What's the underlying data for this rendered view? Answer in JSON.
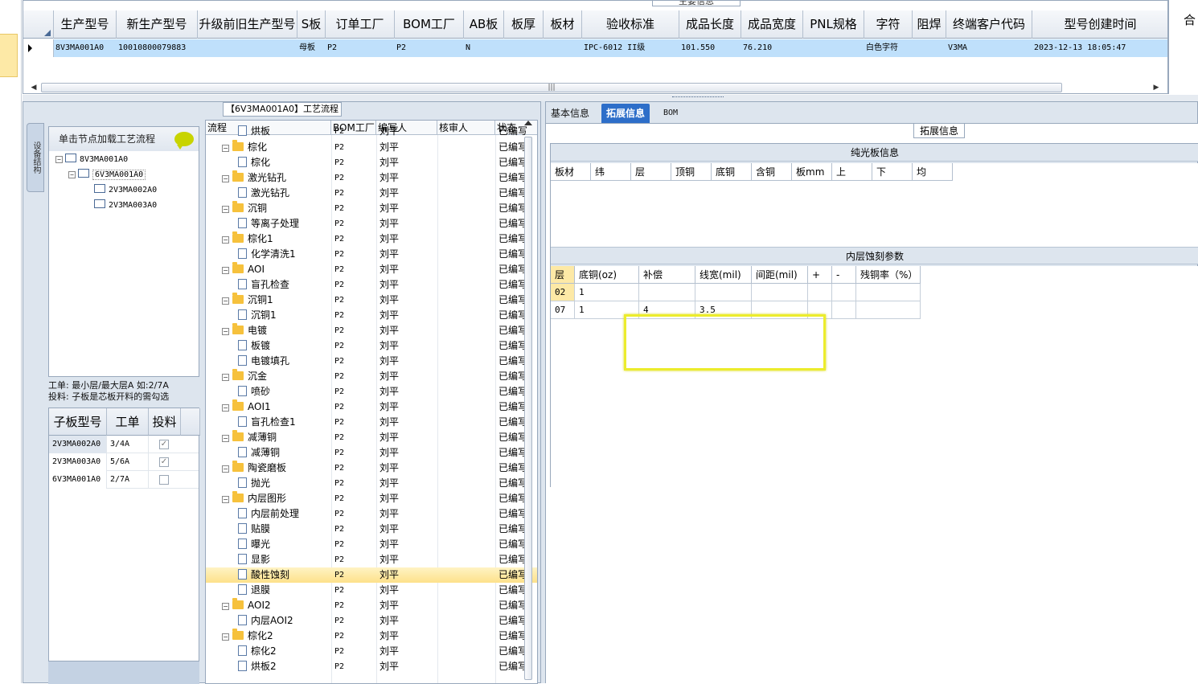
{
  "top_grid": {
    "caption": "主要信息",
    "columns": [
      "生产型号",
      "新生产型号",
      "升级前旧生产型号",
      "S板",
      "订单工厂",
      "BOM工厂",
      "AB板",
      "板厚",
      "板材",
      "验收标准",
      "成品长度",
      "成品宽度",
      "PNL规格",
      "字符",
      "阻焊",
      "终端客户代码",
      "型号创建时间"
    ],
    "row": [
      "8V3MA001A0",
      "10010800079883",
      "",
      "母板",
      "P2",
      "P2",
      "N",
      "",
      "",
      "IPC-6012 II级",
      "101.550",
      "76.210",
      "",
      "白色字符",
      "",
      "V3MA",
      "2023-12-13 18:05:47"
    ],
    "right_cut_label": "合"
  },
  "left_panel": {
    "caption": "【6V3MA001A0】工艺流程",
    "vertical_tab": "设备结构",
    "tree_header": "单击节点加载工艺流程",
    "tree": [
      "8V3MA001A0",
      "6V3MA001A0",
      "2V3MA002A0",
      "2V3MA003A0"
    ],
    "hint_line1": "工单: 最小层/最大层A 如:2/7A",
    "hint_line2": "投料: 子板是芯板开料的需勾选",
    "sub_headers": [
      "子板型号",
      "工单",
      "投料"
    ],
    "sub_rows": [
      {
        "model": "2V3MA002A0",
        "order": "3/4A",
        "feed": "✓"
      },
      {
        "model": "2V3MA003A0",
        "order": "5/6A",
        "feed": "✓"
      },
      {
        "model": "6V3MA001A0",
        "order": "2/7A",
        "feed": ""
      }
    ]
  },
  "process_grid": {
    "headers": [
      "流程",
      "BOM工厂",
      "编写人",
      "核审人",
      "状态"
    ],
    "rows": [
      {
        "type": "doc",
        "name": "烘板",
        "bom": "P2",
        "writer": "刘平",
        "status": "已编写"
      },
      {
        "type": "folder",
        "name": "棕化",
        "bom": "P2",
        "writer": "刘平",
        "status": "已编写"
      },
      {
        "type": "doc",
        "name": "棕化",
        "bom": "P2",
        "writer": "刘平",
        "status": "已编写"
      },
      {
        "type": "folder",
        "name": "激光钻孔",
        "bom": "P2",
        "writer": "刘平",
        "status": "已编写"
      },
      {
        "type": "doc",
        "name": "激光钻孔",
        "bom": "P2",
        "writer": "刘平",
        "status": "已编写"
      },
      {
        "type": "folder",
        "name": "沉铜",
        "bom": "P2",
        "writer": "刘平",
        "status": "已编写"
      },
      {
        "type": "doc",
        "name": "等离子处理",
        "bom": "P2",
        "writer": "刘平",
        "status": "已编写"
      },
      {
        "type": "folder",
        "name": "棕化1",
        "bom": "P2",
        "writer": "刘平",
        "status": "已编写"
      },
      {
        "type": "doc",
        "name": "化学清洗1",
        "bom": "P2",
        "writer": "刘平",
        "status": "已编写"
      },
      {
        "type": "folder",
        "name": "AOI",
        "bom": "P2",
        "writer": "刘平",
        "status": "已编写"
      },
      {
        "type": "doc",
        "name": "盲孔检查",
        "bom": "P2",
        "writer": "刘平",
        "status": "已编写"
      },
      {
        "type": "folder",
        "name": "沉铜1",
        "bom": "P2",
        "writer": "刘平",
        "status": "已编写"
      },
      {
        "type": "doc",
        "name": "沉铜1",
        "bom": "P2",
        "writer": "刘平",
        "status": "已编写"
      },
      {
        "type": "folder",
        "name": "电镀",
        "bom": "P2",
        "writer": "刘平",
        "status": "已编写"
      },
      {
        "type": "doc",
        "name": "板镀",
        "bom": "P2",
        "writer": "刘平",
        "status": "已编写"
      },
      {
        "type": "doc",
        "name": "电镀填孔",
        "bom": "P2",
        "writer": "刘平",
        "status": "已编写"
      },
      {
        "type": "folder",
        "name": "沉金",
        "bom": "P2",
        "writer": "刘平",
        "status": "已编写"
      },
      {
        "type": "doc",
        "name": "喷砂",
        "bom": "P2",
        "writer": "刘平",
        "status": "已编写"
      },
      {
        "type": "folder",
        "name": "AOI1",
        "bom": "P2",
        "writer": "刘平",
        "status": "已编写"
      },
      {
        "type": "doc",
        "name": "盲孔检查1",
        "bom": "P2",
        "writer": "刘平",
        "status": "已编写"
      },
      {
        "type": "folder",
        "name": "减薄铜",
        "bom": "P2",
        "writer": "刘平",
        "status": "已编写"
      },
      {
        "type": "doc",
        "name": "减薄铜",
        "bom": "P2",
        "writer": "刘平",
        "status": "已编写"
      },
      {
        "type": "folder",
        "name": "陶瓷磨板",
        "bom": "P2",
        "writer": "刘平",
        "status": "已编写"
      },
      {
        "type": "doc",
        "name": "抛光",
        "bom": "P2",
        "writer": "刘平",
        "status": "已编写"
      },
      {
        "type": "folder",
        "name": "内层图形",
        "bom": "P2",
        "writer": "刘平",
        "status": "已编写"
      },
      {
        "type": "doc",
        "name": "内层前处理",
        "bom": "P2",
        "writer": "刘平",
        "status": "已编写"
      },
      {
        "type": "doc",
        "name": "贴膜",
        "bom": "P2",
        "writer": "刘平",
        "status": "已编写"
      },
      {
        "type": "doc",
        "name": "曝光",
        "bom": "P2",
        "writer": "刘平",
        "status": "已编写"
      },
      {
        "type": "doc",
        "name": "显影",
        "bom": "P2",
        "writer": "刘平",
        "status": "已编写"
      },
      {
        "type": "doc",
        "name": "酸性蚀刻",
        "bom": "P2",
        "writer": "刘平",
        "status": "已编写",
        "selected": true
      },
      {
        "type": "doc",
        "name": "退膜",
        "bom": "P2",
        "writer": "刘平",
        "status": "已编写"
      },
      {
        "type": "folder",
        "name": "AOI2",
        "bom": "P2",
        "writer": "刘平",
        "status": "已编写"
      },
      {
        "type": "doc",
        "name": "内层AOI2",
        "bom": "P2",
        "writer": "刘平",
        "status": "已编写"
      },
      {
        "type": "folder",
        "name": "棕化2",
        "bom": "P2",
        "writer": "刘平",
        "status": "已编写"
      },
      {
        "type": "doc",
        "name": "棕化2",
        "bom": "P2",
        "writer": "刘平",
        "status": "已编写"
      },
      {
        "type": "doc",
        "name": "烘板2",
        "bom": "P2",
        "writer": "刘平",
        "status": "已编写"
      }
    ]
  },
  "right_panel": {
    "tabs": [
      "基本信息",
      "拓展信息",
      "BOM"
    ],
    "active_tab": "拓展信息",
    "ext_caption": "拓展信息",
    "section1_title": "纯光板信息",
    "section1_headers": [
      "板材",
      "纬",
      "层",
      "顶铜",
      "底铜",
      "含铜",
      "板mm",
      "上",
      "下",
      "均"
    ],
    "section2_title": "内层蚀刻参数",
    "section2_headers": [
      "层",
      "底铜(oz)",
      "补偿",
      "线宽(mil)",
      "间距(mil)",
      "+",
      "-",
      "残铜率（%）"
    ],
    "section2_rows": [
      [
        "02",
        "1",
        "",
        "",
        "",
        "",
        "",
        ""
      ],
      [
        "07",
        "1",
        "4",
        "3.5",
        "",
        "",
        "",
        ""
      ]
    ]
  },
  "colors": {
    "selection": "#bfe0fb",
    "active_tab": "#2d6ec9",
    "highlight_box": "#ecec2c",
    "row_selected": "#fde18a"
  }
}
